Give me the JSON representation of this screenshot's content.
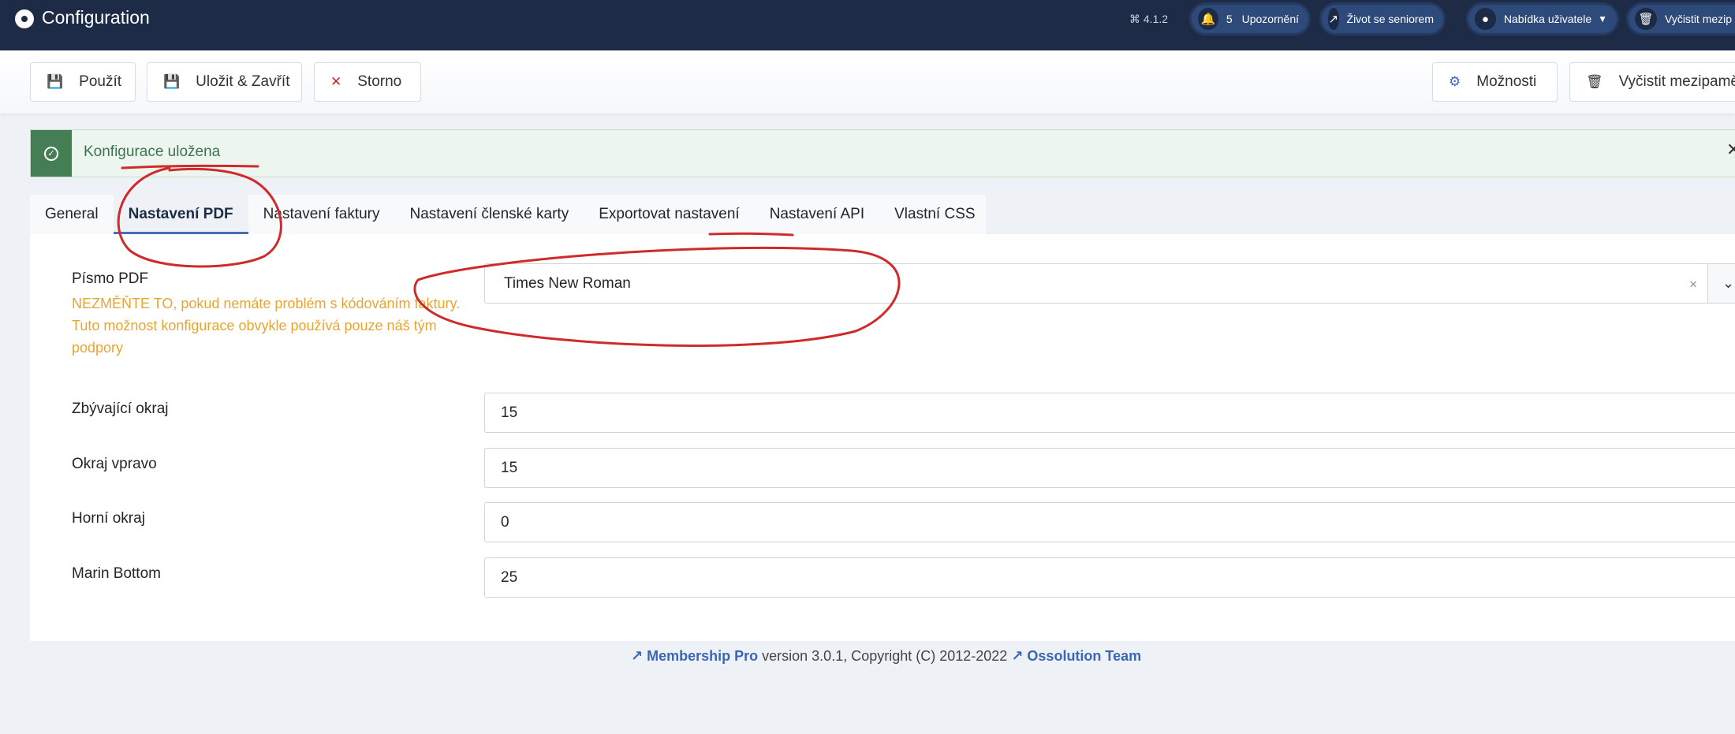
{
  "header": {
    "title": "Configuration",
    "version": "⌘ 4.1.2",
    "notifications": {
      "count": "5",
      "label": "Upozornění"
    },
    "site_link": "Život se seniorem",
    "user_menu": "Nabídka uživatele",
    "clear_cache": "Vyčistit mezip"
  },
  "toolbar": {
    "use_label": "Použít",
    "save_close_label": "Uložit & Zavřít",
    "cancel_label": "Storno",
    "options_label": "Možnosti",
    "clear_cache_label": "Vyčistit mezipamě"
  },
  "alert": {
    "message": "Konfigurace uložena"
  },
  "tabs": [
    {
      "label": "General"
    },
    {
      "label": "Nastavení PDF",
      "active": true
    },
    {
      "label": "Nastavení faktury"
    },
    {
      "label": "Nastavení členské karty"
    },
    {
      "label": "Exportovat nastavení"
    },
    {
      "label": "Nastavení API"
    },
    {
      "label": "Vlastní CSS"
    }
  ],
  "form": {
    "pdf_font": {
      "label": "Písmo PDF",
      "help": "NEZMĚŇTE TO, pokud nemáte problém s kódováním faktury. Tuto možnost konfigurace obvykle používá pouze náš tým podpory",
      "value": "Times New Roman"
    },
    "margin_left": {
      "label": "Zbývající okraj",
      "value": "15"
    },
    "margin_right": {
      "label": "Okraj vpravo",
      "value": "15"
    },
    "margin_top": {
      "label": "Horní okraj",
      "value": "0"
    },
    "margin_bottom": {
      "label": "Marin Bottom",
      "value": "25"
    }
  },
  "footer": {
    "product_link": "Membership Pro",
    "text": " version 3.0.1, Copyright (C) 2012-2022 ",
    "team_link": "Ossolution Team"
  },
  "colors": {
    "header_bg": "#1e2b46",
    "success": "#457d54",
    "help_text": "#e8a533",
    "annotation_red": "#d02a2a",
    "link": "#3a67b3"
  }
}
